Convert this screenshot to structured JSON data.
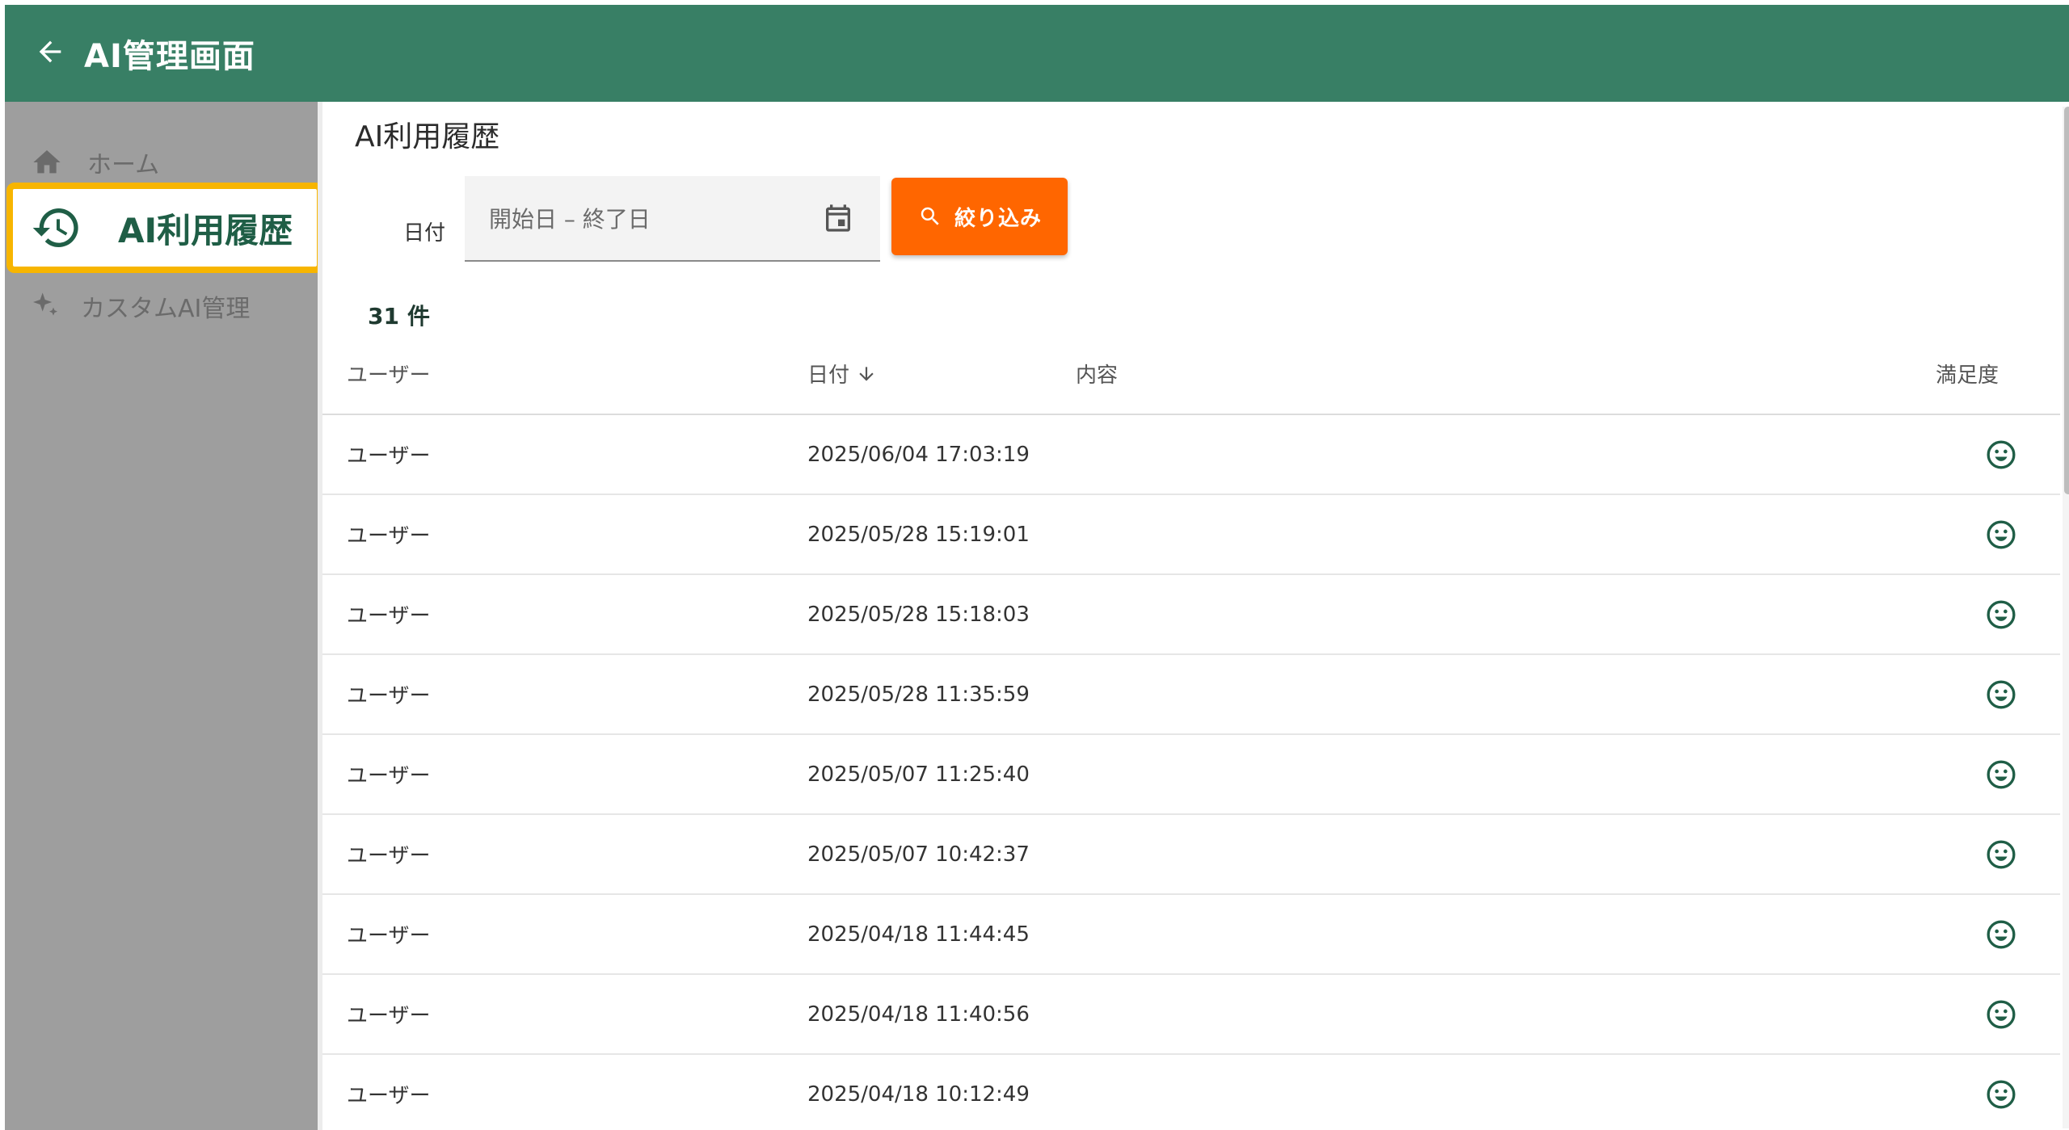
{
  "header": {
    "title": "AI管理画面",
    "back_icon": "arrow-left-icon"
  },
  "sidebar": {
    "items": [
      {
        "label": "ホーム",
        "icon": "home-icon"
      },
      {
        "label": "AI利用履歴",
        "icon": "history-icon",
        "active": true
      },
      {
        "label": "カスタムAI管理",
        "icon": "sparkle-icon"
      }
    ]
  },
  "main": {
    "title": "AI利用履歴",
    "filter": {
      "label": "日付",
      "date_placeholder": "開始日 – 終了日",
      "button_label": "絞り込み"
    },
    "count": {
      "value": "31",
      "unit": "件"
    },
    "table": {
      "columns": {
        "user": "ユーザー",
        "date": "日付",
        "content": "内容",
        "satisfaction": "満足度"
      },
      "rows": [
        {
          "user": "ユーザー",
          "date": "2025/06/04 17:03:19",
          "content": "",
          "content_line2": "",
          "satisfaction": "smiley-icon"
        },
        {
          "user": "ユーザー",
          "date": "2025/05/28 15:19:01",
          "content": "",
          "satisfaction": "smiley-icon"
        },
        {
          "user": "ユーザー",
          "date": "2025/05/28 15:18:03",
          "content": "",
          "satisfaction": "smiley-icon"
        },
        {
          "user": "ユーザー",
          "date": "2025/05/28 11:35:59",
          "content": "",
          "satisfaction": "smiley-icon"
        },
        {
          "user": "ユーザー",
          "date": "2025/05/07 11:25:40",
          "content": "",
          "satisfaction": "smiley-icon"
        },
        {
          "user": "ユーザー",
          "date": "2025/05/07 10:42:37",
          "content": "",
          "satisfaction": "smiley-icon"
        },
        {
          "user": "ユーザー",
          "date": "2025/04/18 11:44:45",
          "content": "",
          "satisfaction": "smiley-icon"
        },
        {
          "user": "ユーザー",
          "date": "2025/04/18 11:40:56",
          "content": "",
          "satisfaction": "smiley-icon"
        },
        {
          "user": "ユーザー",
          "date": "2025/04/18 10:12:49",
          "content": "",
          "satisfaction": "smiley-icon"
        }
      ]
    }
  },
  "colors": {
    "header_bg": "#387f65",
    "sidebar_bg": "#9e9e9e",
    "highlight_border": "#f7b500",
    "button_bg": "#ff6600",
    "active_text": "#1f5e46"
  }
}
